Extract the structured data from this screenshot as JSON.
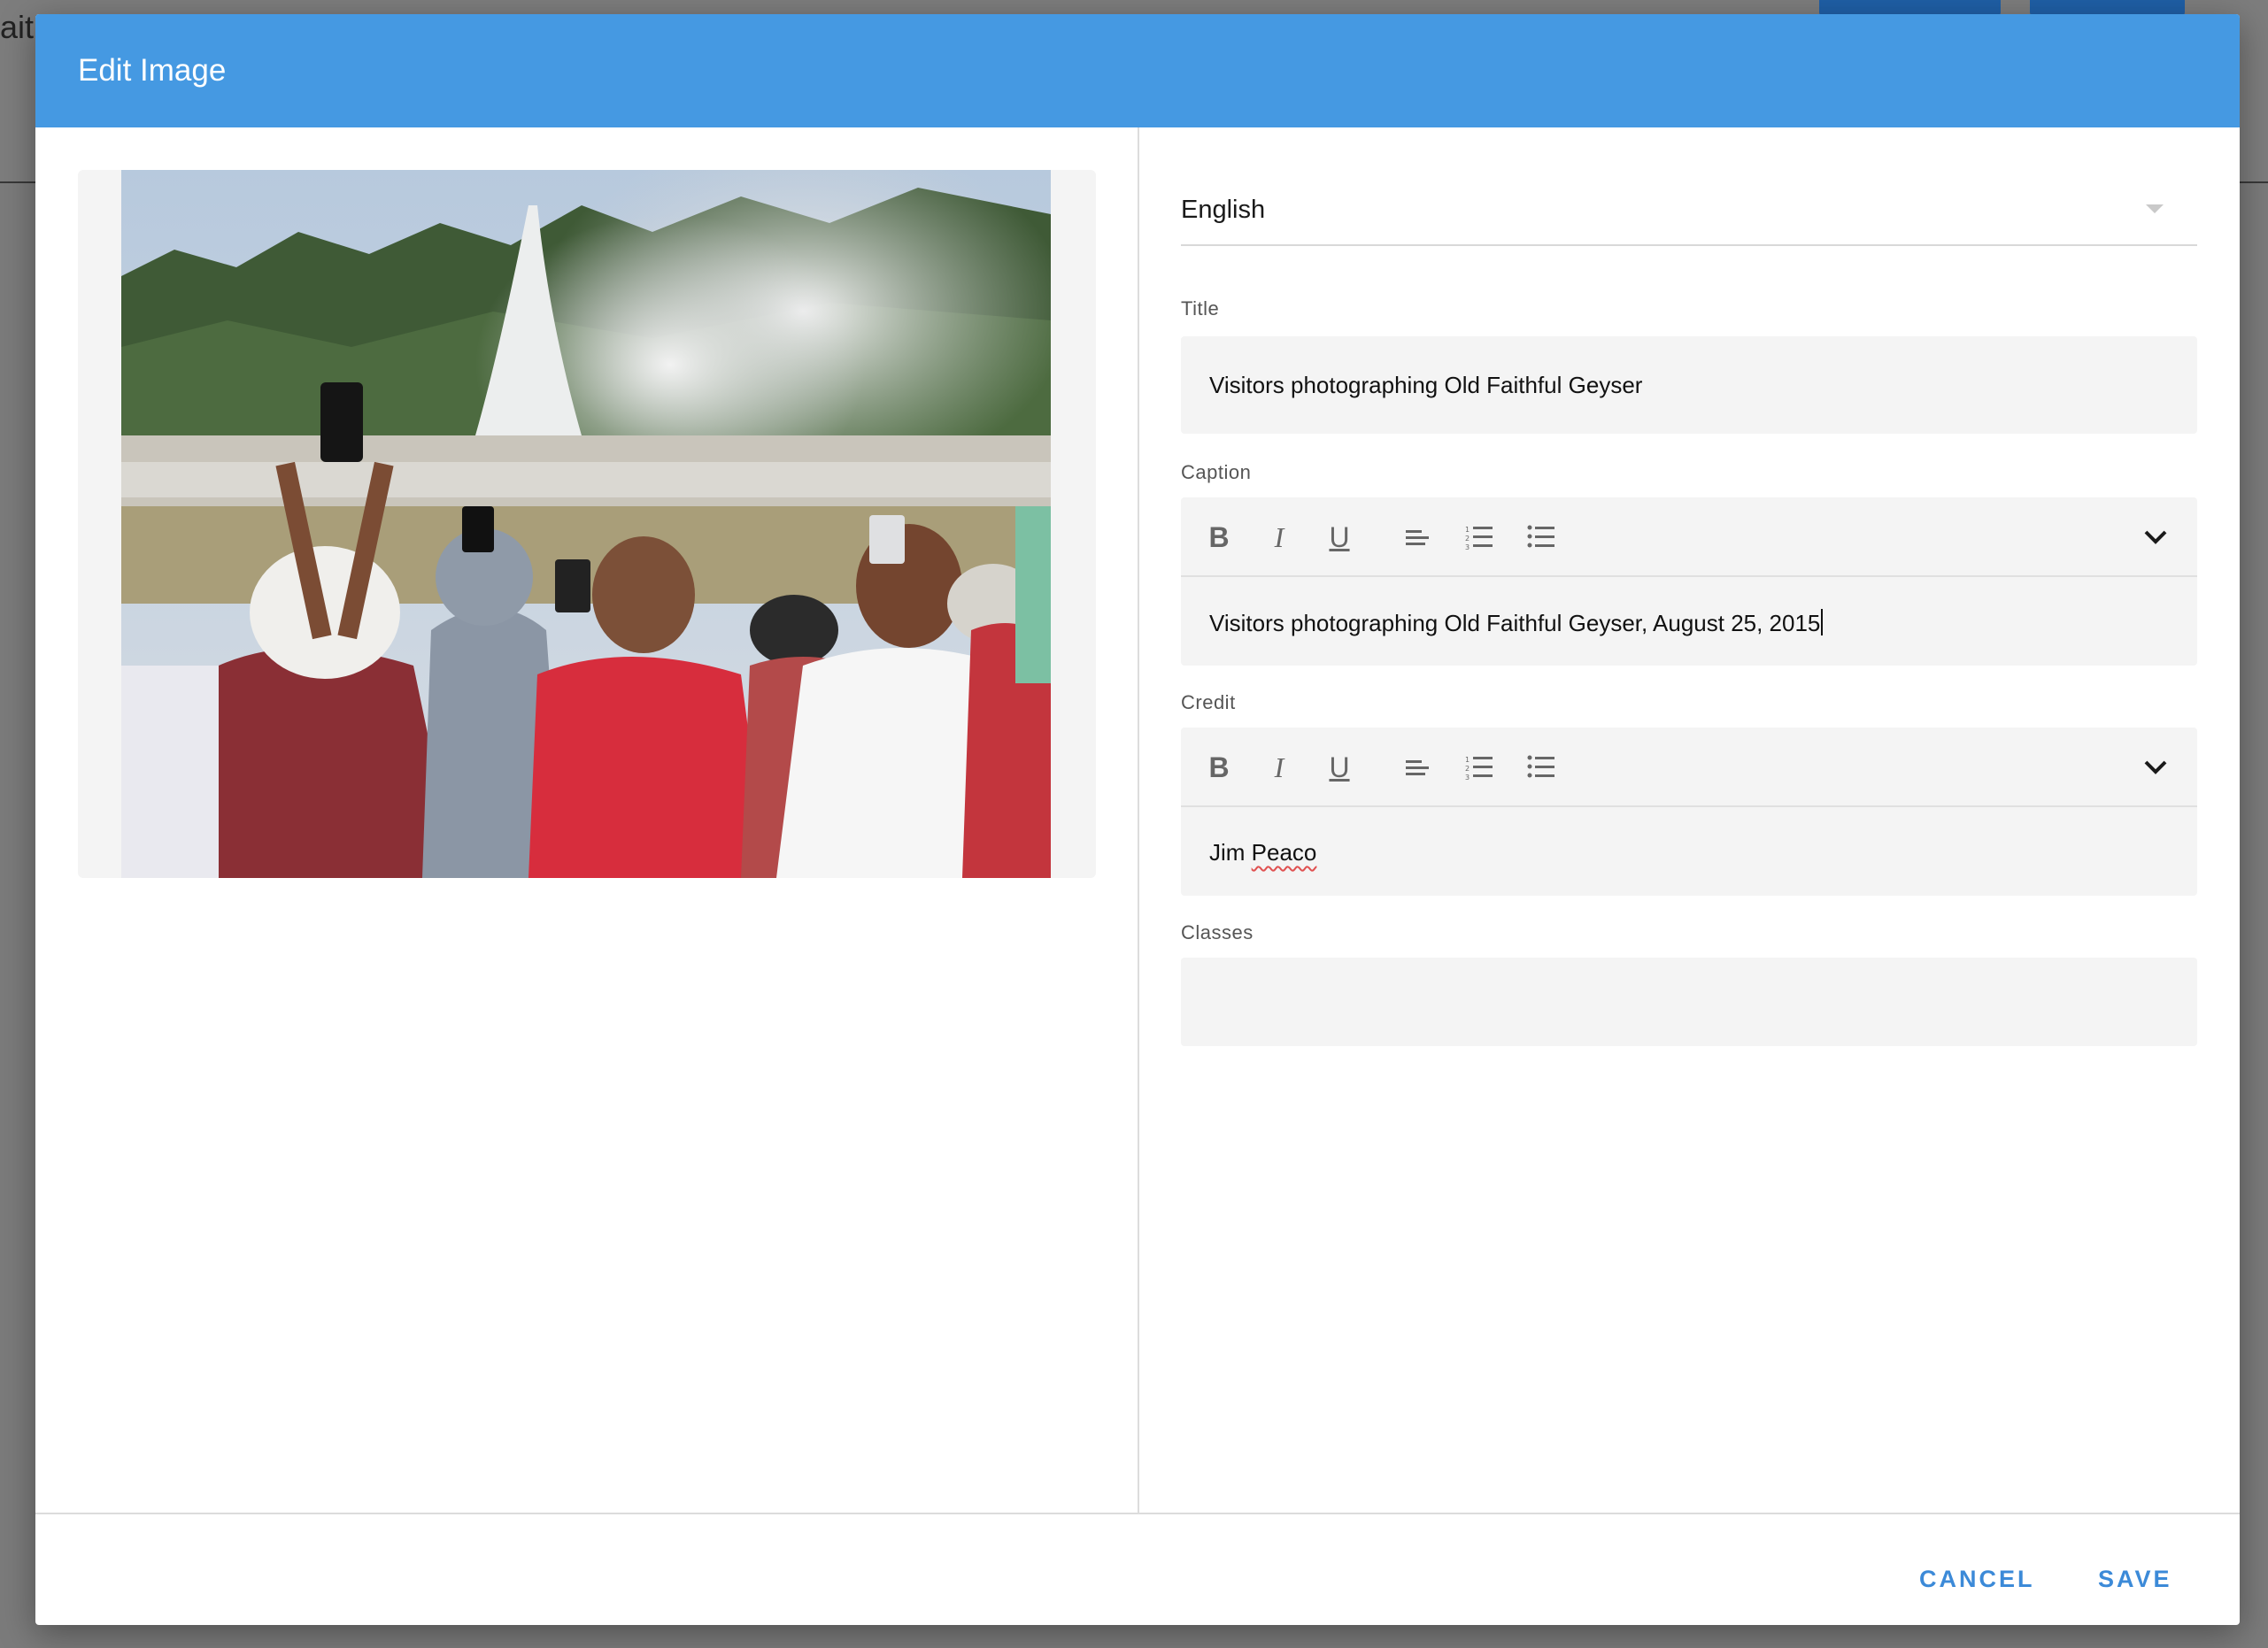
{
  "background": {
    "text_fragment": "aith"
  },
  "dialog": {
    "title": "Edit Image"
  },
  "language_select": {
    "value": "English"
  },
  "fields": {
    "title": {
      "label": "Title",
      "value": "Visitors photographing Old Faithful Geyser"
    },
    "caption": {
      "label": "Caption",
      "value": "Visitors photographing Old Faithful Geyser, August 25, 2015"
    },
    "credit": {
      "label": "Credit",
      "value_first": "Jim",
      "value_second": "Peaco"
    },
    "classes": {
      "label": "Classes",
      "value": ""
    }
  },
  "toolbar_icons": [
    "bold-icon",
    "italic-icon",
    "underline-icon",
    "align-left-icon",
    "ordered-list-icon",
    "bullet-list-icon",
    "chevron-down-icon"
  ],
  "toolbar_glyphs": {
    "bold": "B",
    "italic": "I",
    "underline": "U"
  },
  "footer": {
    "cancel_label": "CANCEL",
    "save_label": "SAVE"
  },
  "colors": {
    "header": "#4599e2",
    "action": "#3c8ad8",
    "field_bg": "#f4f4f4"
  }
}
